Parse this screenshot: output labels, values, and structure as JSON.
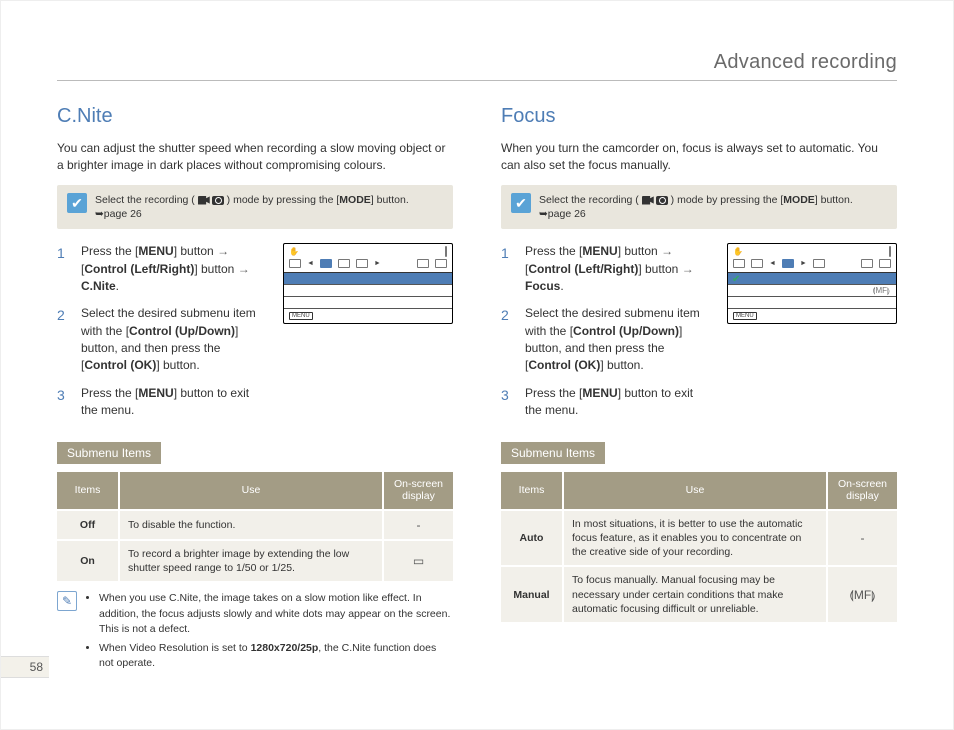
{
  "page_number": "58",
  "chapter": "Advanced recording",
  "info_hint_prefix": "Select the recording (",
  "info_hint_suffix": ") mode by pressing the [",
  "info_hint_mode": "MODE",
  "info_hint_end": "] button. ➥page 26",
  "submenu_label": "Submenu Items",
  "table_headers": {
    "items": "Items",
    "use": "Use",
    "osd": "On-screen display"
  },
  "left": {
    "title": "C.Nite",
    "lede": "You can adjust the shutter speed when recording a slow moving object or a brighter image in dark places without compromising colours.",
    "steps": [
      {
        "n": "1",
        "html": "Press the [<b>MENU</b>] button <span class='arrowglyph'>→</span> [<b>Control (Left/Right)</b>] button <span class='arrowglyph'>→</span> <b>C.Nite</b>."
      },
      {
        "n": "2",
        "html": "Select the desired submenu item with the [<b>Control (Up/Down)</b>] button, and then press the [<b>Control (OK)</b>] button."
      },
      {
        "n": "3",
        "html": "Press the [<b>MENU</b>] button to exit the menu."
      }
    ],
    "table": [
      {
        "item": "Off",
        "use": "To disable the function.",
        "osd": "-"
      },
      {
        "item": "On",
        "use": "To record a brighter image by extending the low shutter speed range to 1/50 or 1/25.",
        "osd": "▭"
      }
    ],
    "notes": [
      "When you use C.Nite, the image takes on a slow motion like effect. In addition, the focus adjusts slowly and white dots may appear on the screen. This is not a defect.",
      "When Video Resolution is set to <b>1280x720/25p</b>, the C.Nite function does not operate."
    ]
  },
  "right": {
    "title": "Focus",
    "lede": "When you turn the camcorder on, focus is always set to automatic. You can also set the focus manually.",
    "steps": [
      {
        "n": "1",
        "html": "Press the [<b>MENU</b>] button <span class='arrowglyph'>→</span> [<b>Control (Left/Right)</b>] button <span class='arrowglyph'>→</span> <b>Focus</b>."
      },
      {
        "n": "2",
        "html": "Select the desired submenu item with the [<b>Control (Up/Down)</b>] button, and then press the [<b>Control (OK)</b>] button."
      },
      {
        "n": "3",
        "html": "Press the [<b>MENU</b>] button to exit the menu."
      }
    ],
    "table": [
      {
        "item": "Auto",
        "use": "In most situations, it is better to use the automatic focus feature, as it enables you to concentrate on the creative side of your recording.",
        "osd": "-"
      },
      {
        "item": "Manual",
        "use": "To focus manually. Manual focusing may be necessary under certain conditions that make automatic focusing difficult or unreliable.",
        "osd": "⟬MF⟭"
      }
    ]
  }
}
